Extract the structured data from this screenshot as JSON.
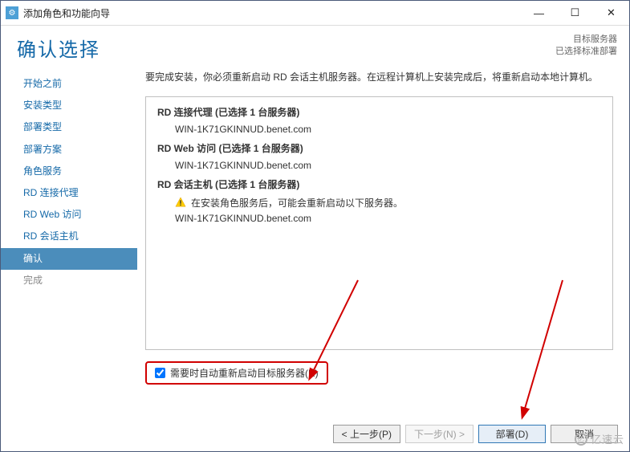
{
  "titlebar": {
    "title": "添加角色和功能向导"
  },
  "header": {
    "page_title": "确认选择",
    "target_label": "目标服务器",
    "target_value": "已选择标准部署"
  },
  "sidebar": {
    "items": [
      {
        "label": "开始之前",
        "state": "link"
      },
      {
        "label": "安装类型",
        "state": "link"
      },
      {
        "label": "部署类型",
        "state": "link"
      },
      {
        "label": "部署方案",
        "state": "link"
      },
      {
        "label": "角色服务",
        "state": "link"
      },
      {
        "label": "RD 连接代理",
        "state": "link"
      },
      {
        "label": "RD Web 访问",
        "state": "link"
      },
      {
        "label": "RD 会话主机",
        "state": "link"
      },
      {
        "label": "确认",
        "state": "active"
      },
      {
        "label": "完成",
        "state": "disabled"
      }
    ]
  },
  "main": {
    "intro": "要完成安装，你必须重新启动 RD 会话主机服务器。在远程计算机上安装完成后，将重新启动本地计算机。",
    "sections": [
      {
        "head": "RD 连接代理  (已选择 1 台服务器)",
        "items": [
          {
            "text": "WIN-1K71GKINNUD.benet.com",
            "warn": false
          }
        ]
      },
      {
        "head": "RD Web 访问  (已选择 1 台服务器)",
        "items": [
          {
            "text": "WIN-1K71GKINNUD.benet.com",
            "warn": false
          }
        ]
      },
      {
        "head": "RD 会话主机  (已选择 1 台服务器)",
        "items": [
          {
            "text": "在安装角色服务后，可能会重新启动以下服务器。",
            "warn": true
          },
          {
            "text": "WIN-1K71GKINNUD.benet.com",
            "warn": false
          }
        ]
      }
    ],
    "checkbox_label": "需要时自动重新启动目标服务器(R)"
  },
  "footer": {
    "prev": "< 上一步(P)",
    "next": "下一步(N) >",
    "deploy": "部署(D)",
    "cancel": "取消"
  },
  "watermark": "亿速云"
}
